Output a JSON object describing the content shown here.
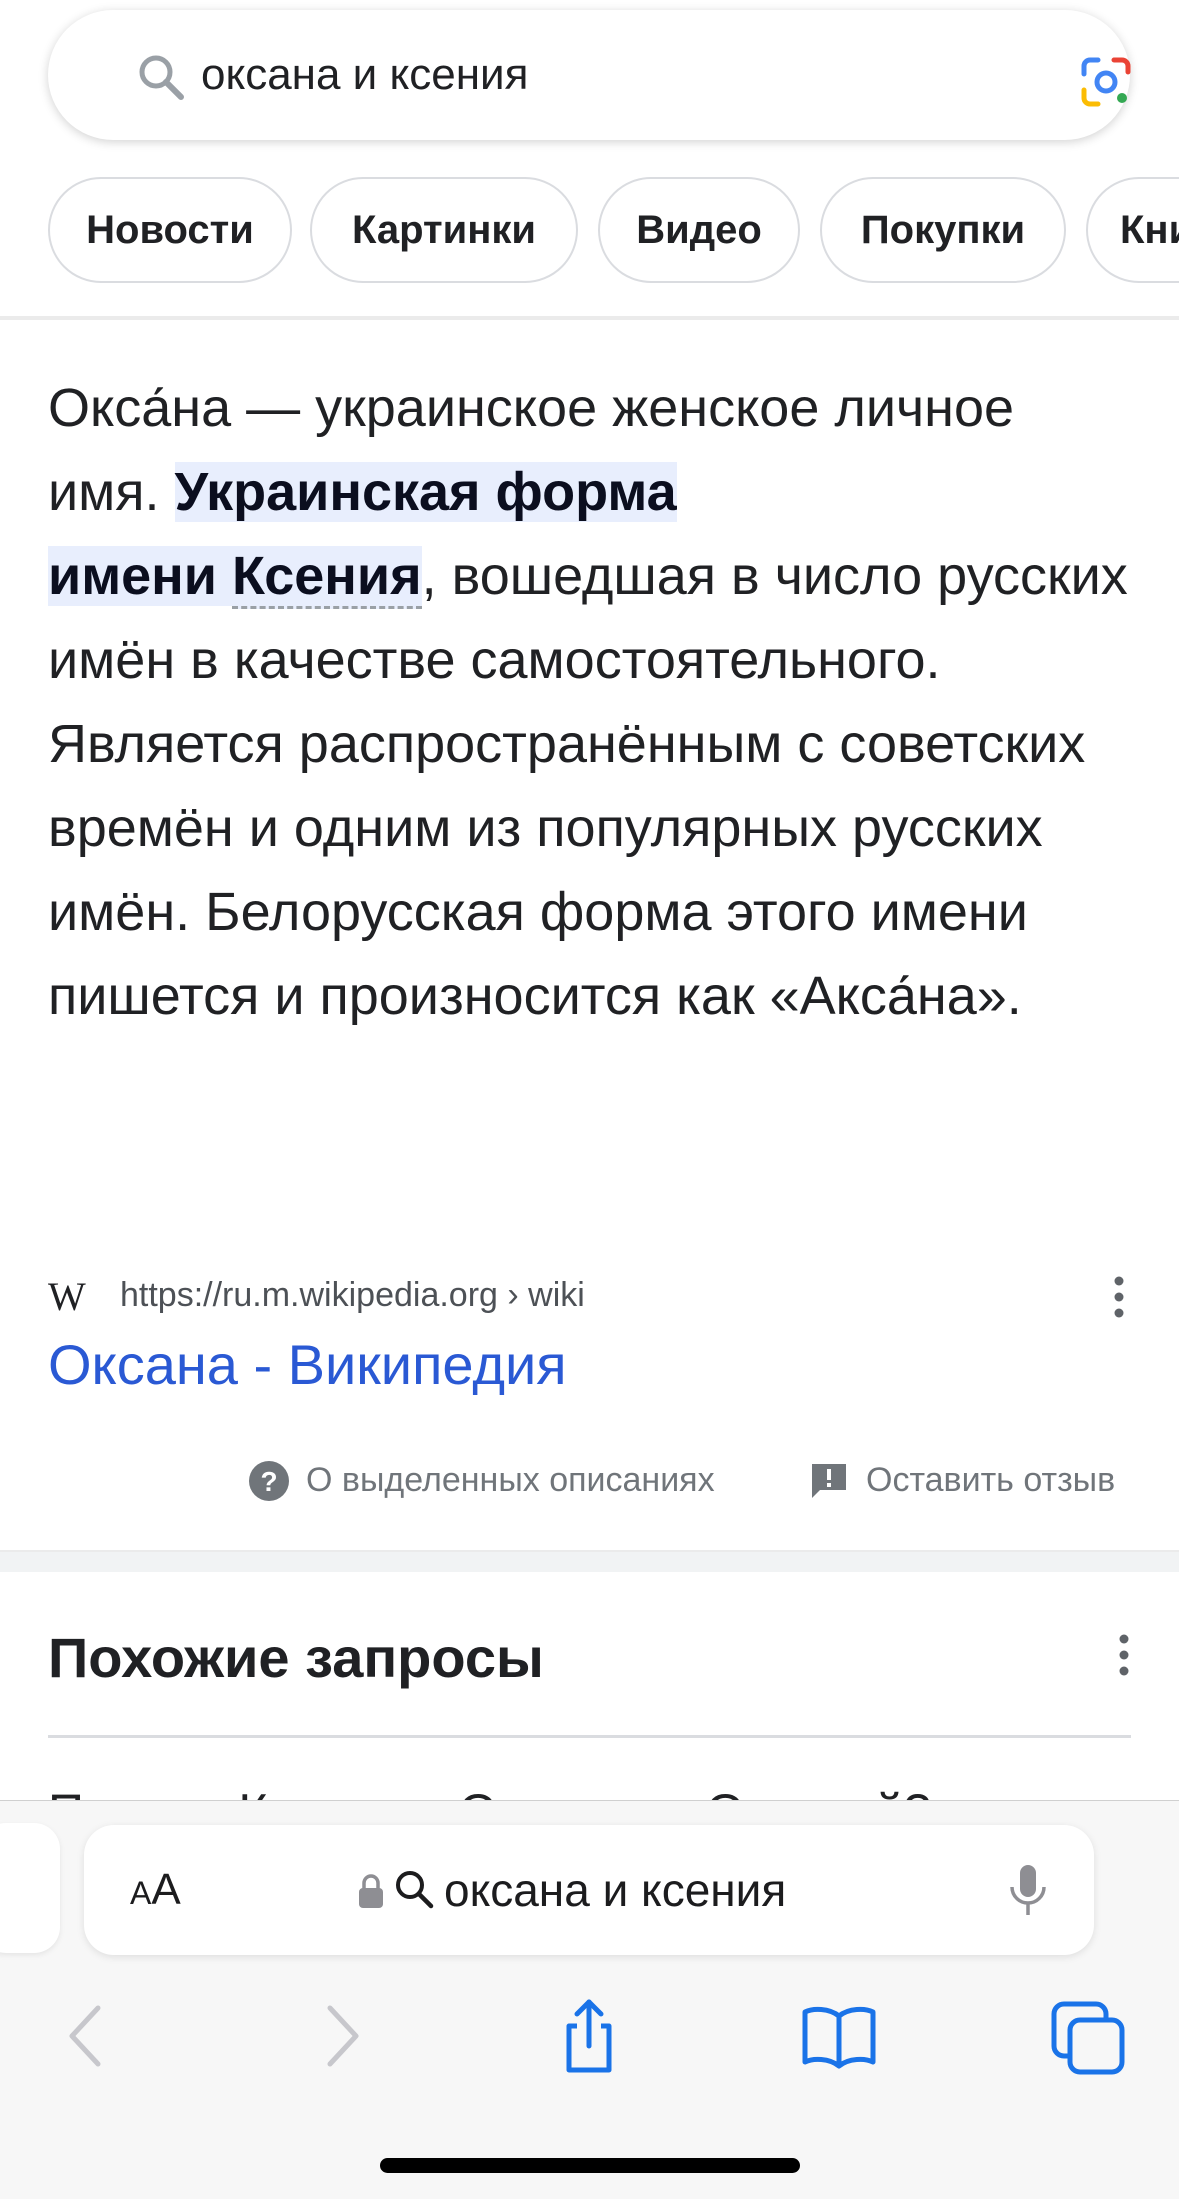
{
  "search": {
    "query": "оксана и ксения"
  },
  "chips": [
    {
      "label": "Новости"
    },
    {
      "label": "Картинки"
    },
    {
      "label": "Видео"
    },
    {
      "label": "Покупки"
    },
    {
      "label": "Кни"
    }
  ],
  "snippet": {
    "part1": "Окса́на — украинское женское личное имя. ",
    "highlight1": "Украинская форма",
    "highlight2a": "имени ",
    "highlight2b": "Ксения",
    "part2": ", вошедшая в число русских имён в качестве самостоятельного. Является распространённым с советских времён и одним из популярных русских имён. Белорусская форма этого имени пишется и произносится как «Акса́на»."
  },
  "source": {
    "logo": "W",
    "url": "https://ru.m.wikipedia.org › wiki",
    "title": "Оксана - Википедия"
  },
  "feedback": {
    "about": "О выделенных описаниях",
    "leave": "Оставить отзыв"
  },
  "related": {
    "title": "Похожие запросы",
    "peek": "Почему Ксения и Оксана — Оксаной?"
  },
  "safari": {
    "aa_small": "A",
    "aa_large": "A",
    "url": "оксана и ксения"
  },
  "colors": {
    "link": "#2a59d4",
    "highlight": "#e8eefd",
    "safari_blue": "#1a73e8"
  }
}
